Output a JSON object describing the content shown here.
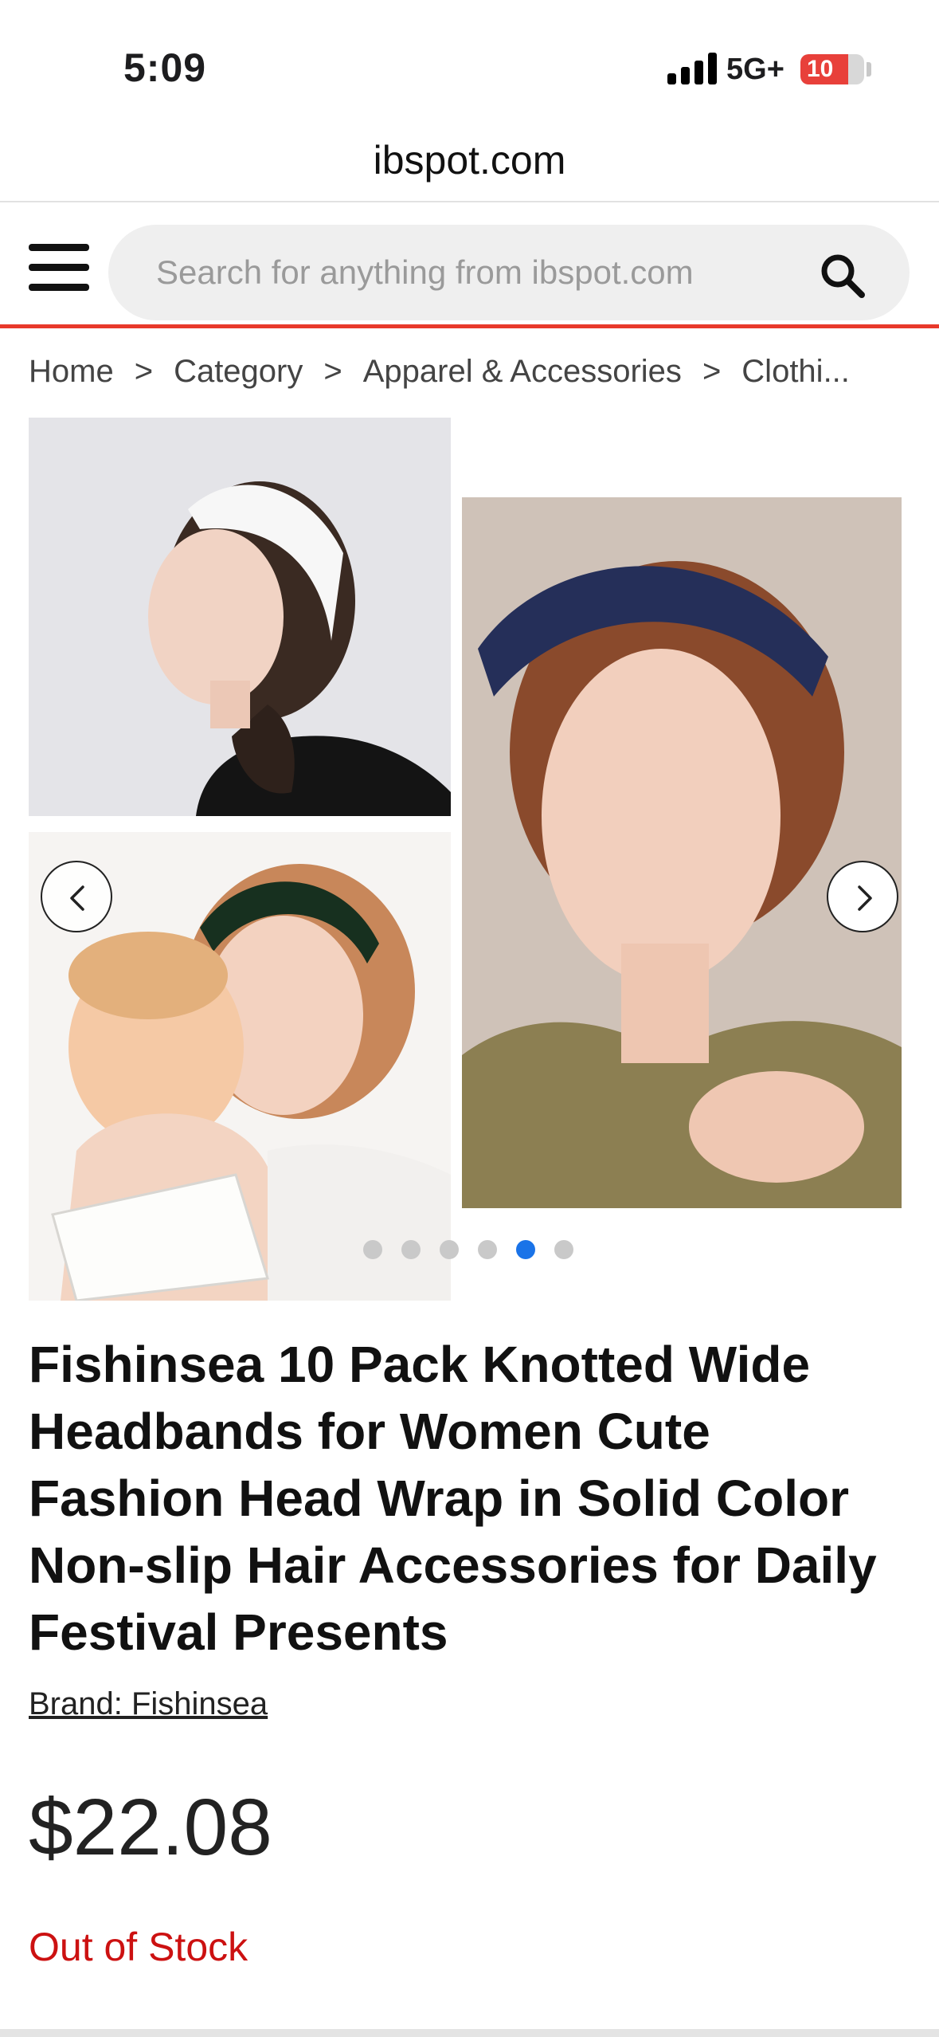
{
  "status_bar": {
    "time": "5:09",
    "network": "5G+",
    "battery": "10"
  },
  "browser": {
    "url": "ibspot.com"
  },
  "header": {
    "search_placeholder": "Search for anything from ibspot.com",
    "accent_color": "#e8392b"
  },
  "breadcrumb": {
    "items": [
      "Home",
      "Category",
      "Apparel & Accessories",
      "Clothi..."
    ],
    "separator": ">"
  },
  "gallery": {
    "dot_count": 6,
    "active_dot": 5,
    "active_color": "#1a73e8"
  },
  "product": {
    "title": "Fishinsea 10 Pack Knotted Wide Headbands for Women Cute Fashion Head Wrap in Solid Color Non-slip Hair Accessories for Daily Festival Presents",
    "brand": "Brand: Fishinsea",
    "price": "$22.08",
    "stock_status": "Out of Stock",
    "stock_color": "#cc1111"
  }
}
